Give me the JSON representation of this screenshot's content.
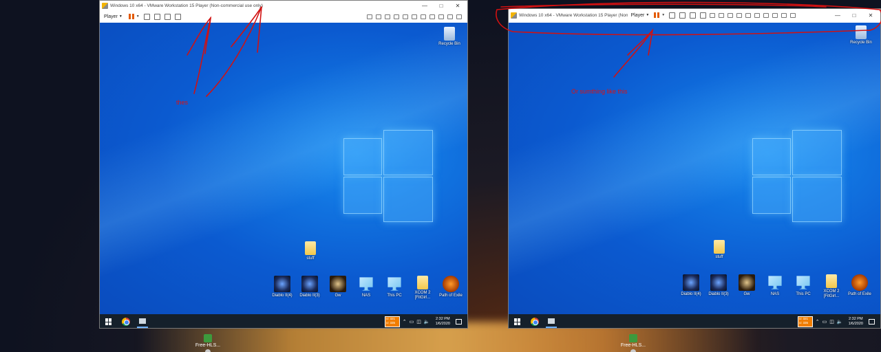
{
  "left_window": {
    "title": "Windows 10 x64 - VMware Workstation 15 Player (Non-commercial use only)",
    "player_menu": "Player",
    "recycle_bin": "Recycle Bin",
    "annotation": "thes",
    "folder_label": "stuff",
    "icons": [
      "Diablo II(4)",
      "Diablo II(3)",
      "Gw",
      "NAS",
      "This PC",
      "XCOM 2 [FitGirl...",
      "Path of Exile"
    ],
    "meter": {
      "line1": "U: 321",
      "line2": "U: 335"
    },
    "clock": {
      "time": "2:32 PM",
      "date": "1/6/2020"
    }
  },
  "right_window": {
    "title": "Windows 10 x64 - VMware Workstation 15 Player (Non",
    "player_menu": "Player",
    "recycle_bin": "Recycle Bin",
    "annotation": "Or sumthing like this",
    "folder_label": "stuff",
    "icons": [
      "Diablo II(4)",
      "Diablo II(3)",
      "Gw",
      "NAS",
      "This PC",
      "XCOM 2 [FitGirl...",
      "Path of Exile"
    ],
    "meter": {
      "line1": "U: 321",
      "line2": "U: 335"
    },
    "clock": {
      "time": "2:32 PM",
      "date": "1/6/2020"
    }
  },
  "host": {
    "icon_label": "Free-HLS..."
  },
  "colors": {
    "annotation": "#d11111",
    "guest_bg": "#1173e0",
    "taskbar": "#15202b",
    "pause": "#e35a00"
  }
}
